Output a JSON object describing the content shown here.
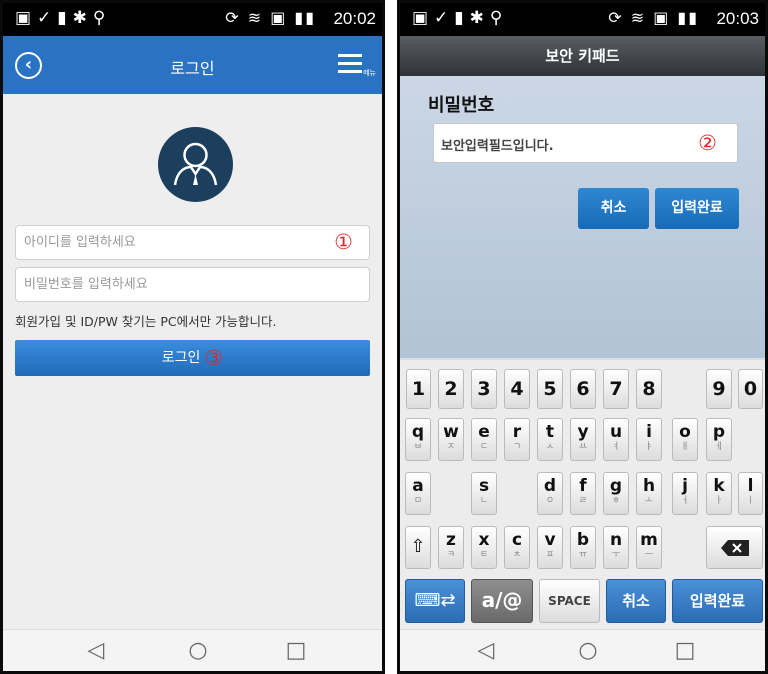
{
  "left_screen": {
    "status": {
      "time": "20:02"
    },
    "header": {
      "title": "로그인",
      "menu_label": "메뉴"
    },
    "form": {
      "id_placeholder": "아이디를 입력하세요",
      "id_marker": "①",
      "pw_placeholder": "비밀번호를 입력하세요",
      "notice": "회원가입 및 ID/PW 찾기는 PC에서만 가능합니다.",
      "login_label": "로그인",
      "login_marker": "③"
    }
  },
  "right_screen": {
    "status": {
      "time": "20:03"
    },
    "header": {
      "title": "보안 키패드"
    },
    "password_label": "비밀번호",
    "secure_field_placeholder": "보안입력필드입니다.",
    "secure_field_marker": "②",
    "cancel_label": "취소",
    "done_label": "입력완료",
    "keyboard": {
      "numbers": [
        "1",
        "2",
        "3",
        "4",
        "5",
        "6",
        "7",
        "8",
        "9",
        "0"
      ],
      "row1": [
        [
          "q",
          "ㅂ"
        ],
        [
          "w",
          "ㅈ"
        ],
        [
          "e",
          "ㄷ"
        ],
        [
          "r",
          "ㄱ"
        ],
        [
          "t",
          "ㅅ"
        ],
        [
          "y",
          "ㅛ"
        ],
        [
          "u",
          "ㅕ"
        ],
        [
          "i",
          "ㅑ"
        ],
        [
          "o",
          "ㅐ"
        ],
        [
          "p",
          "ㅔ"
        ]
      ],
      "row2": [
        [
          "a",
          "ㅁ"
        ],
        [
          "s",
          "ㄴ"
        ],
        [
          "d",
          "ㅇ"
        ],
        [
          "f",
          "ㄹ"
        ],
        [
          "g",
          "ㅎ"
        ],
        [
          "h",
          "ㅗ"
        ],
        [
          "j",
          "ㅓ"
        ],
        [
          "k",
          "ㅏ"
        ],
        [
          "l",
          "ㅣ"
        ]
      ],
      "row3": [
        [
          "z",
          "ㅋ"
        ],
        [
          "x",
          "ㅌ"
        ],
        [
          "c",
          "ㅊ"
        ],
        [
          "v",
          "ㅍ"
        ],
        [
          "b",
          "ㅠ"
        ],
        [
          "n",
          "ㅜ"
        ],
        [
          "m",
          "ㅡ"
        ]
      ],
      "space_label": "SPACE",
      "bottom_cancel": "취소",
      "bottom_done": "입력완료"
    }
  }
}
